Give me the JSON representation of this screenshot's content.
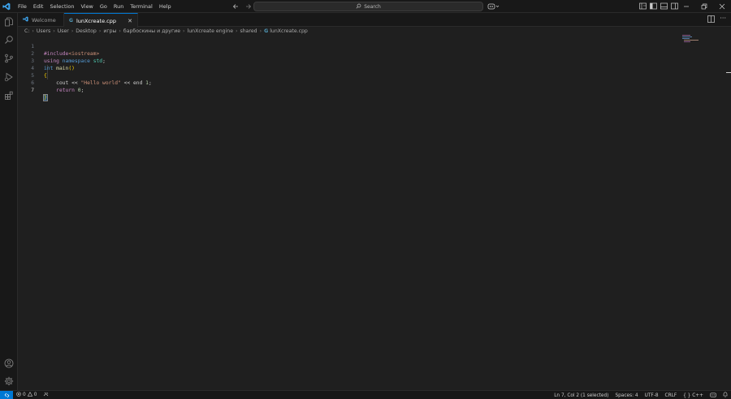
{
  "menu": [
    "File",
    "Edit",
    "Selection",
    "View",
    "Go",
    "Run",
    "Terminal",
    "Help"
  ],
  "search": {
    "label": "Search"
  },
  "tabs": [
    {
      "label": "Welcome"
    },
    {
      "label": "lunXcreate.cpp"
    }
  ],
  "breadcrumb": [
    "C:",
    "Users",
    "User",
    "Desktop",
    "игры",
    "барбоскины и другие",
    "lunXcreate engine",
    "shared",
    "lunXcreate.cpp"
  ],
  "editor": {
    "line_numbers": [
      "1",
      "2",
      "3",
      "4",
      "5",
      "6",
      "7"
    ],
    "lines": [
      [
        "#include",
        "<iostream>"
      ],
      [
        "using",
        " ",
        "namespace",
        " ",
        "std",
        ";"
      ],
      [
        "int",
        " ",
        "main",
        "()"
      ],
      [
        "{"
      ],
      [
        "    ",
        "cout",
        " << ",
        "\"Hello world\"",
        " << ",
        "end",
        " ",
        "1",
        ";"
      ],
      [
        "    ",
        "return",
        " ",
        "0",
        ";"
      ],
      [
        "}"
      ]
    ]
  },
  "status": {
    "errors": "0",
    "warnings": "0",
    "position": "Ln 7, Col 2 (1 selected)",
    "spaces": "Spaces: 4",
    "encoding": "UTF-8",
    "eol": "CRLF",
    "language": "C++"
  },
  "colors": {
    "accent": "#0078d4",
    "background": "#1f1f1f",
    "chrome": "#181818"
  }
}
